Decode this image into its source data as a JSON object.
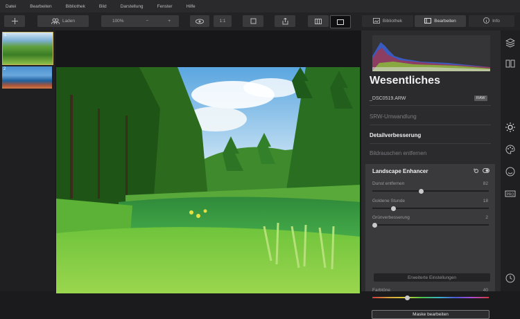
{
  "menu": [
    "Datei",
    "Bearbeiten",
    "Bibliothek",
    "Bild",
    "Darstellung",
    "Fenster",
    "Hilfe"
  ],
  "toolbar": {
    "share_label": "Laden",
    "zoom_value": "100%",
    "zoom_minus": "−",
    "zoom_plus": "+",
    "compare_label": "1:1"
  },
  "tabs": {
    "browse": "Bibliothek",
    "edit": "Bearbeiten",
    "info": "Info"
  },
  "filmstrip": {
    "items": [
      {
        "num": "1"
      },
      {
        "num": "2"
      }
    ]
  },
  "panel": {
    "title": "Wesentliches",
    "filename": "_DSC0519.ARW",
    "raw_badge": "RAW",
    "sections": [
      "SRW-Umwandlung",
      "Detailverbesserung",
      "Bildrauschen entfernen"
    ],
    "tool": {
      "title": "Landscape Enhancer",
      "sliders": [
        {
          "label": "Dunst entfernen",
          "value": "82",
          "fraction": 0.42
        },
        {
          "label": "Goldene Stunde",
          "value": "18",
          "fraction": 0.18
        },
        {
          "label": "Grünverbesserung",
          "value": "2",
          "fraction": 0.02
        }
      ],
      "advanced_button": "Erweiterte Einstellungen",
      "hue": {
        "label": "Farbtöne",
        "value": "40",
        "fraction": 0.3
      },
      "mask_button": "Maske bearbeiten"
    }
  },
  "colors": {
    "accent": "#c8b25c",
    "panel": "#2b2b2e"
  }
}
